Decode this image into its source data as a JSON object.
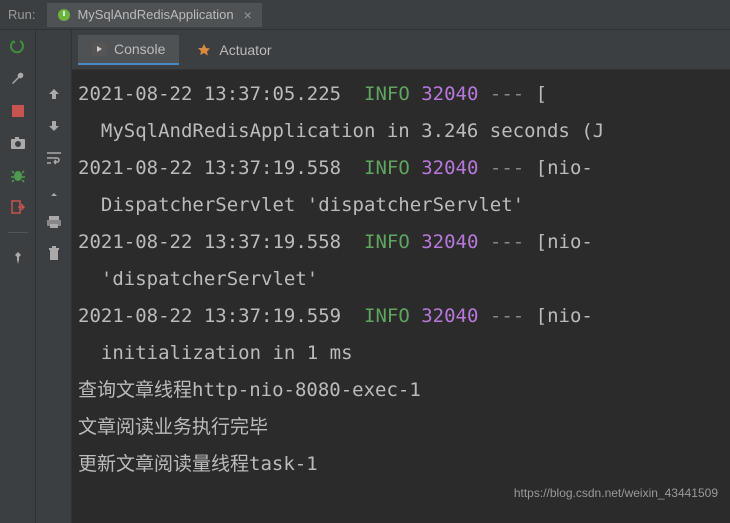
{
  "top": {
    "run_label": "Run:",
    "config_name": "MySqlAndRedisApplication",
    "close_glyph": "×"
  },
  "tabs": {
    "console_label": "Console",
    "actuator_label": "Actuator"
  },
  "icons": {
    "rerun": "rerun-icon",
    "wrench": "wrench-icon",
    "stop": "stop-icon",
    "camera": "camera-icon",
    "bug": "bug-icon",
    "exit": "exit-icon",
    "pin": "pin-icon",
    "arrow_up": "arrow-up-icon",
    "arrow_down": "arrow-down-icon",
    "wrap": "wrap-icon",
    "scroll": "scroll-end-icon",
    "print": "print-icon",
    "trash": "trash-icon"
  },
  "colors": {
    "info": "#5fa55f",
    "pid": "#b877db",
    "bg": "#2b2b2b",
    "panel": "#3c3f41"
  },
  "log": {
    "lines": [
      {
        "ts": "2021-08-22 13:37:05.225",
        "level": "INFO",
        "pid": "32040",
        "sep": "---",
        "thread": "[",
        "msg": ""
      },
      {
        "indent": "  ",
        "msg": "MySqlAndRedisApplication in 3.246 seconds (J"
      },
      {
        "ts": "2021-08-22 13:37:19.558",
        "level": "INFO",
        "pid": "32040",
        "sep": "---",
        "thread": "[nio-",
        "msg": ""
      },
      {
        "indent": "  ",
        "msg": "DispatcherServlet 'dispatcherServlet'"
      },
      {
        "ts": "2021-08-22 13:37:19.558",
        "level": "INFO",
        "pid": "32040",
        "sep": "---",
        "thread": "[nio-",
        "msg": ""
      },
      {
        "indent": "  ",
        "msg": "'dispatcherServlet'"
      },
      {
        "ts": "2021-08-22 13:37:19.559",
        "level": "INFO",
        "pid": "32040",
        "sep": "---",
        "thread": "[nio-",
        "msg": ""
      },
      {
        "indent": "  ",
        "msg": "initialization in 1 ms"
      }
    ],
    "plain": [
      "查询文章线程http-nio-8080-exec-1",
      "文章阅读业务执行完毕",
      "更新文章阅读量线程task-1"
    ]
  },
  "watermark": "https://blog.csdn.net/weixin_43441509"
}
